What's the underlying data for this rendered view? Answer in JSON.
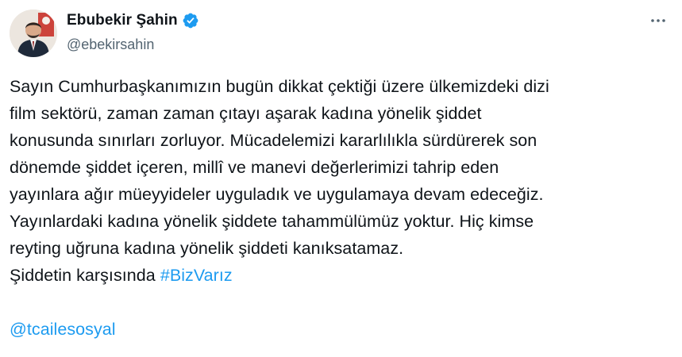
{
  "author": {
    "display_name": "Ebubekir Şahin",
    "handle": "@ebekirsahin",
    "verified": true
  },
  "icons": {
    "verified": "verified-badge-icon",
    "more": "more-options-icon",
    "avatar": "profile-photo"
  },
  "colors": {
    "text": "#0f1419",
    "secondary": "#536471",
    "link": "#1d9bf0",
    "verified_badge": "#1d9bf0"
  },
  "tweet": {
    "lines": [
      "Sayın Cumhurbaşkanımızın bugün dikkat çektiği üzere ülkemizdeki dizi",
      "film sektörü, zaman zaman çıtayı aşarak kadına yönelik şiddet",
      "konusunda sınırları zorluyor. Mücadelemizi kararlılıkla sürdürerek son",
      "dönemde şiddet içeren, millî ve manevi değerlerimizi tahrip eden",
      "yayınlara ağır müeyyideler uyguladık ve uygulamaya devam edeceğiz.",
      "Yayınlardaki kadına yönelik şiddete tahammülümüz yoktur. Hiç kimse",
      "reyting uğruna kadına yönelik şiddeti kanıksatamaz."
    ],
    "last_line_text": "Şiddetin karşısında ",
    "hashtag": "#BizVarız",
    "mention": "@tcailesosyal"
  }
}
